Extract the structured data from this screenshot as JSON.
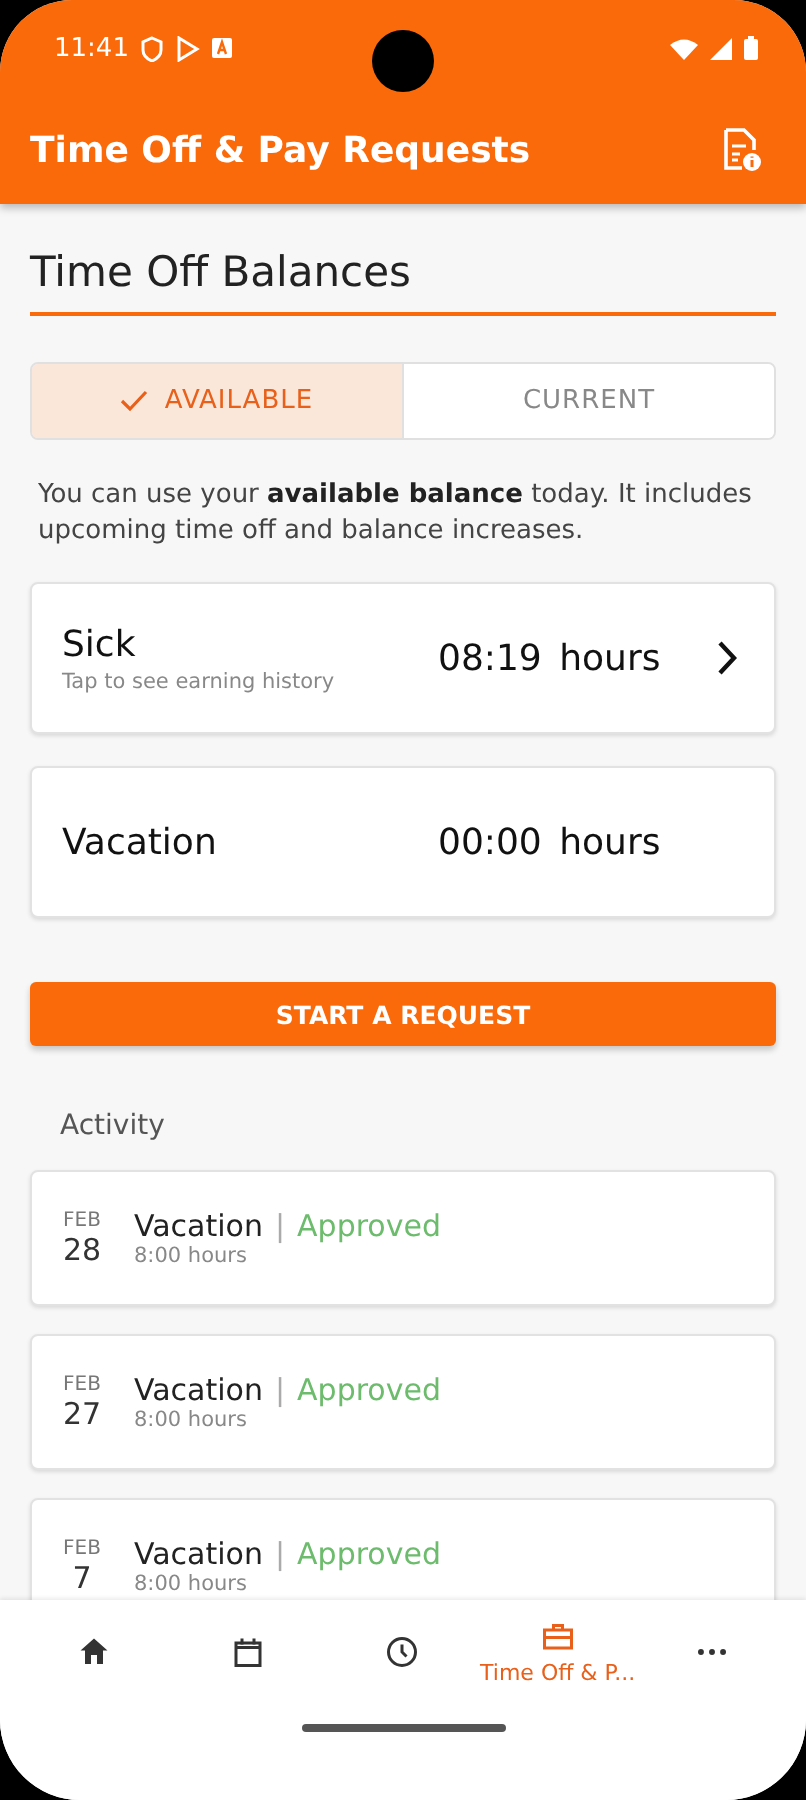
{
  "status_bar": {
    "time": "11:41"
  },
  "app_bar": {
    "title": "Time Off & Pay Requests"
  },
  "section_title": "Time Off Balances",
  "segments": [
    {
      "label": "AVAILABLE",
      "selected": true
    },
    {
      "label": "CURRENT",
      "selected": false
    }
  ],
  "info_text": "You can use your **available balance** today. It includes upcoming time off and balance increases.",
  "balances": [
    {
      "name": "Sick",
      "hint": "Tap to see earning history",
      "amount": "08:19",
      "unit": "hours",
      "navigable": true
    },
    {
      "name": "Vacation",
      "amount": "00:00",
      "unit": "hours",
      "navigable": false
    }
  ],
  "start_button": "START A REQUEST",
  "activity": {
    "title": "Activity",
    "items": [
      {
        "month": "FEB",
        "day": "28",
        "type": "Vacation",
        "separator": "|",
        "status": "Approved",
        "hours": "8:00 hours"
      },
      {
        "month": "FEB",
        "day": "27",
        "type": "Vacation",
        "separator": "|",
        "status": "Approved",
        "hours": "8:00 hours"
      },
      {
        "month": "FEB",
        "day": "7",
        "type": "Vacation",
        "separator": "|",
        "status": "Approved",
        "hours": "8:00 hours"
      }
    ]
  },
  "bottom_nav": [
    {
      "kind": "home",
      "selected": false
    },
    {
      "kind": "calendar",
      "selected": false
    },
    {
      "kind": "clock",
      "selected": false
    },
    {
      "kind": "briefcase",
      "label": "Time Off & P...",
      "selected": true
    },
    {
      "kind": "more",
      "selected": false
    }
  ]
}
